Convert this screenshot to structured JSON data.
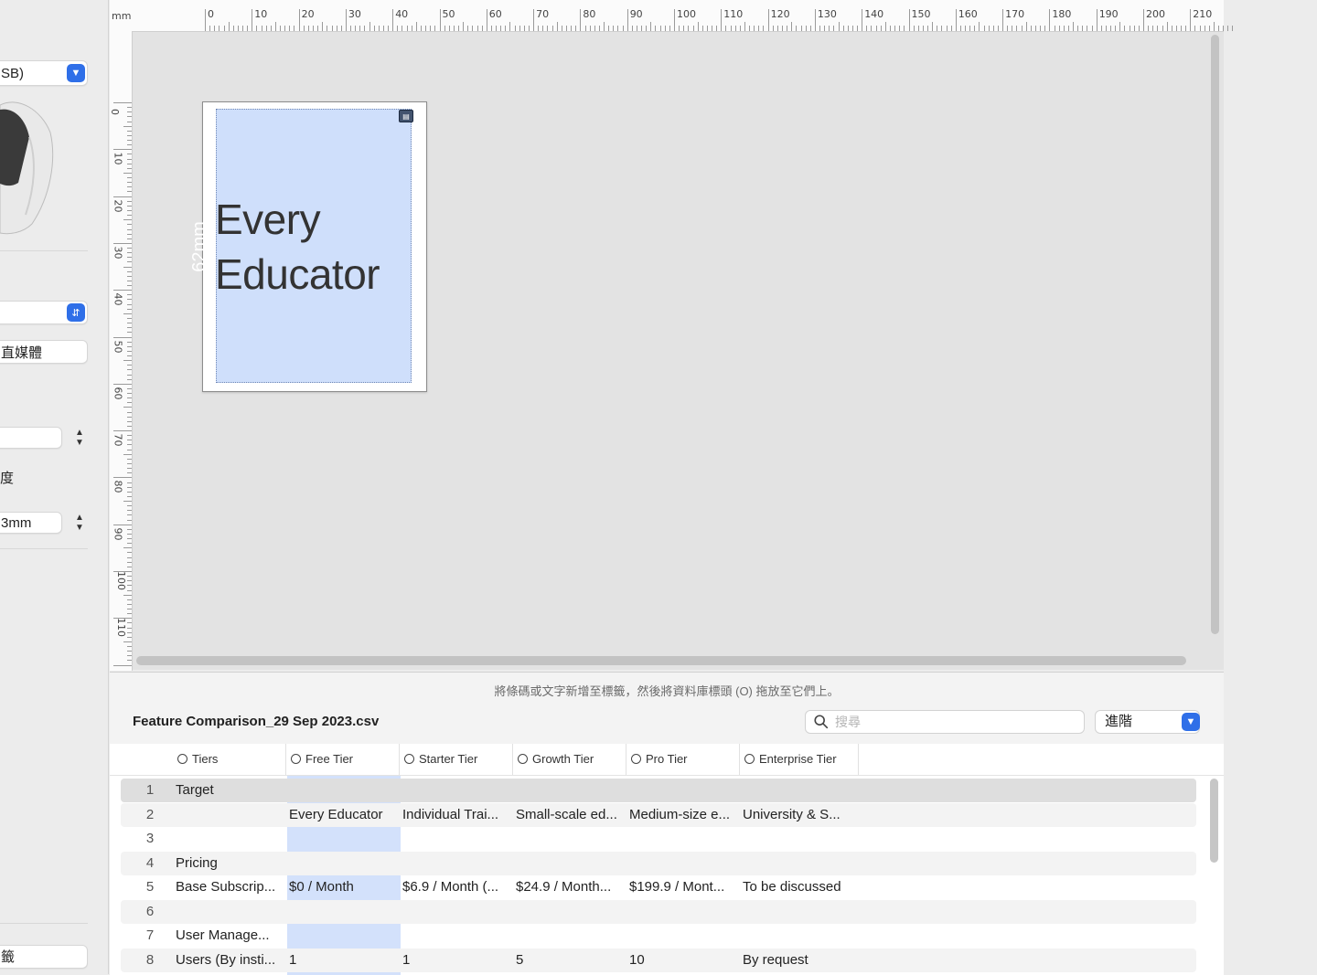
{
  "sidebar": {
    "connection_value": "SB)",
    "media_label": "直媒體",
    "length_label": "度",
    "length_value": "3mm",
    "bottom_label": "籤"
  },
  "ruler": {
    "unit": "mm",
    "top_labels": [
      "0",
      "10",
      "20",
      "30",
      "40",
      "50",
      "60",
      "70",
      "80",
      "90",
      "100",
      "110",
      "120",
      "130",
      "140",
      "150",
      "160",
      "170",
      "180",
      "190",
      "200",
      "210"
    ],
    "left_labels": [
      "0",
      "10",
      "20",
      "30",
      "40",
      "50",
      "60",
      "70",
      "80",
      "90",
      "100",
      "110",
      "0"
    ]
  },
  "label": {
    "dimension": "62mm",
    "text_line1": "Every",
    "text_line2": "Educator"
  },
  "database": {
    "hint": "將條碼或文字新增至標籤，然後將資料庫標頭 (O) 拖放至它們上。",
    "file_name": "Feature Comparison_29 Sep 2023.csv",
    "search_placeholder": "搜尋",
    "advanced_label": "進階",
    "columns": [
      "Tiers",
      "Free Tier",
      "Starter Tier",
      "Growth Tier",
      "Pro Tier",
      "Enterprise Tier"
    ],
    "rows": [
      {
        "n": "1",
        "cells": [
          "Target",
          "",
          "",
          "",
          "",
          ""
        ]
      },
      {
        "n": "2",
        "cells": [
          "",
          "Every Educator",
          "Individual Trai...",
          "Small-scale ed...",
          "Medium-size e...",
          "University & S..."
        ]
      },
      {
        "n": "3",
        "cells": [
          "",
          "",
          "",
          "",
          "",
          ""
        ]
      },
      {
        "n": "4",
        "cells": [
          "Pricing",
          "",
          "",
          "",
          "",
          ""
        ]
      },
      {
        "n": "5",
        "cells": [
          "Base Subscrip...",
          "$0 / Month",
          "$6.9 / Month (...",
          "$24.9 / Month...",
          "$199.9 / Mont...",
          "To be discussed"
        ]
      },
      {
        "n": "6",
        "cells": [
          "",
          "",
          "",
          "",
          "",
          ""
        ]
      },
      {
        "n": "7",
        "cells": [
          "User Manage...",
          "",
          "",
          "",
          "",
          ""
        ]
      },
      {
        "n": "8",
        "cells": [
          "Users (By insti...",
          "1",
          "1",
          "5",
          "10",
          "By request"
        ]
      }
    ]
  },
  "colors": {
    "accent": "#2f6fe8",
    "selection": "#cfdffb"
  }
}
